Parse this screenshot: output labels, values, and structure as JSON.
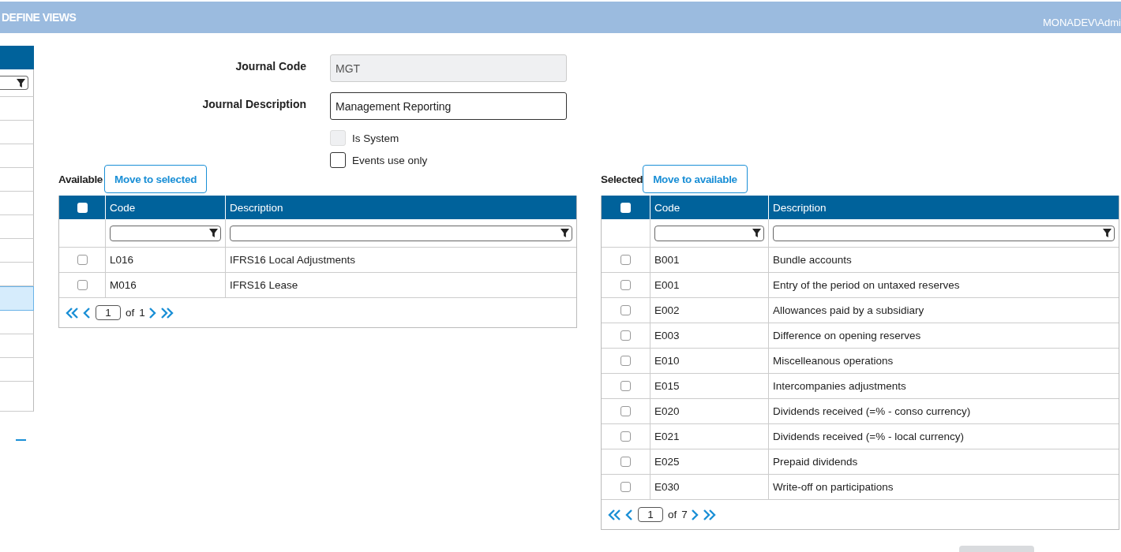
{
  "header": {
    "title": "DEFINE VIEWS",
    "user": "MONADEV\\Admi"
  },
  "side_list": {
    "rows": [
      {
        "selected": false
      },
      {
        "selected": false
      },
      {
        "selected": false
      },
      {
        "selected": false
      },
      {
        "selected": false
      },
      {
        "selected": false
      },
      {
        "selected": false
      },
      {
        "selected": false
      },
      {
        "selected": true
      },
      {
        "selected": false
      },
      {
        "selected": false
      },
      {
        "selected": false
      },
      {
        "selected": false
      }
    ]
  },
  "form": {
    "fields": [
      {
        "label": "Journal Code",
        "value": "MGT",
        "disabled": true
      },
      {
        "label": "Journal Description",
        "value": "Management Reporting",
        "disabled": false
      }
    ],
    "checkboxes": [
      {
        "label": "Is System",
        "checked": false,
        "disabled": true
      },
      {
        "label": "Events use only",
        "checked": false,
        "disabled": false
      }
    ]
  },
  "lists": [
    {
      "label": "Available",
      "button": "Move to selected",
      "columns": [
        "Code",
        "Description"
      ],
      "all_checked": false,
      "rows": [
        {
          "checked": false,
          "code": "L016",
          "description": "IFRS16 Local Adjustments"
        },
        {
          "checked": false,
          "code": "M016",
          "description": "IFRS16 Lease"
        }
      ],
      "pager": {
        "page": "1",
        "of": "of",
        "total": "1"
      }
    },
    {
      "label": "Selected",
      "button": "Move to available",
      "columns": [
        "Code",
        "Description"
      ],
      "all_checked": false,
      "rows": [
        {
          "checked": false,
          "code": "B001",
          "description": "Bundle accounts"
        },
        {
          "checked": false,
          "code": "E001",
          "description": "Entry of the period on untaxed reserves"
        },
        {
          "checked": false,
          "code": "E002",
          "description": "Allowances paid by a subsidiary"
        },
        {
          "checked": false,
          "code": "E003",
          "description": "Difference on opening reserves"
        },
        {
          "checked": false,
          "code": "E010",
          "description": "Miscelleanous operations"
        },
        {
          "checked": false,
          "code": "E015",
          "description": "Intercompanies adjustments"
        },
        {
          "checked": false,
          "code": "E020",
          "description": "Dividends received (=% - conso currency)"
        },
        {
          "checked": false,
          "code": "E021",
          "description": "Dividends received (=% - local currency)"
        },
        {
          "checked": false,
          "code": "E025",
          "description": "Prepaid dividends"
        },
        {
          "checked": false,
          "code": "E030",
          "description": "Write-off on participations"
        }
      ],
      "pager": {
        "page": "1",
        "of": "of",
        "total": "7"
      }
    }
  ]
}
